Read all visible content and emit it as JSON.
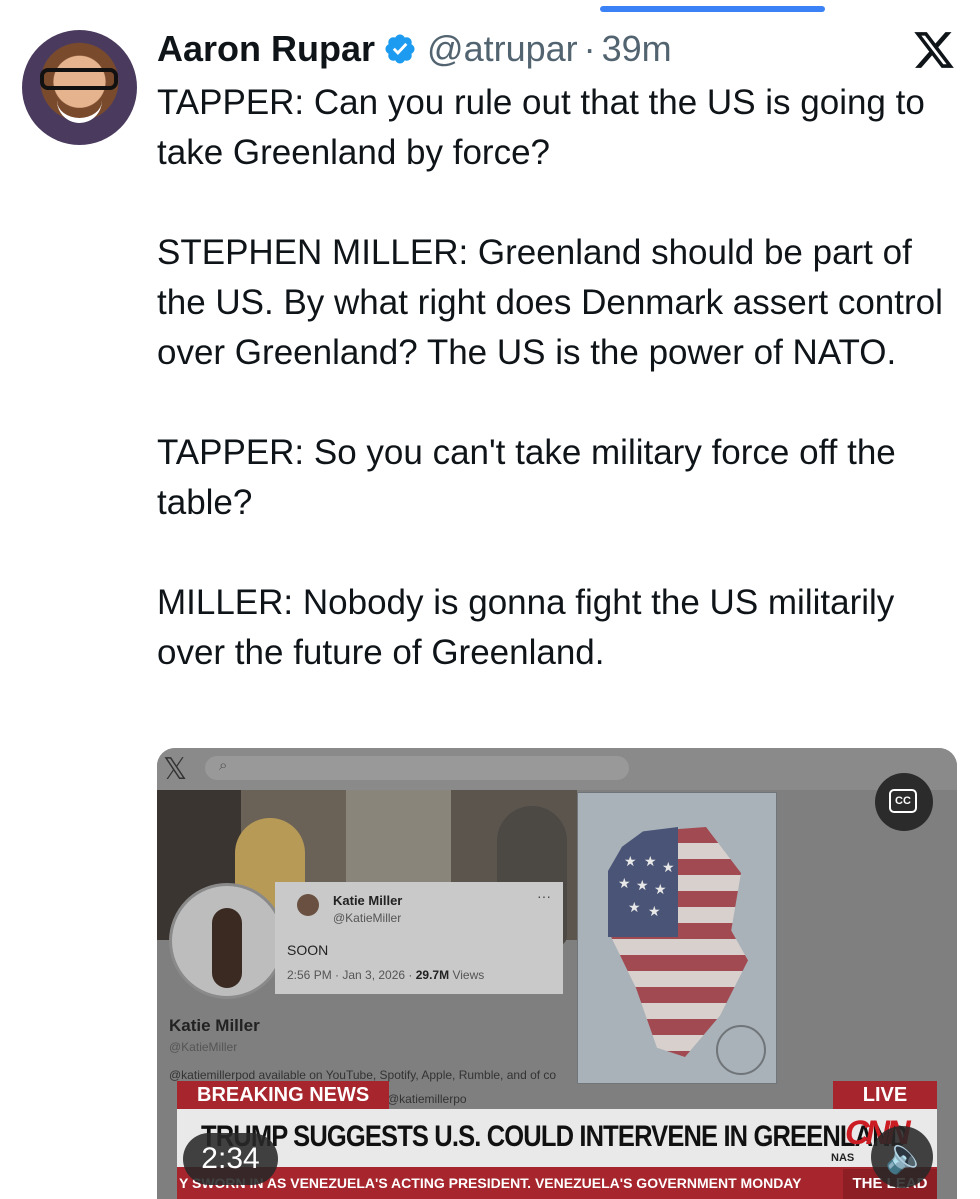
{
  "author": {
    "name": "Aaron Rupar",
    "handle": "@atrupar",
    "separator": "·",
    "time": "39m"
  },
  "tweet": {
    "text": "TAPPER: Can you rule out that the US is going to take Greenland by force?\n\nSTEPHEN MILLER: Greenland should be part of the US. By what right does Denmark assert control over Greenland? The US is the power of NATO.\n\nTAPPER: So you can't take military force off the table?\n\nMILLER: Nobody is gonna fight the US militarily over the future of Greenland."
  },
  "video": {
    "embedded_post": {
      "name": "Katie Miller",
      "handle": "@KatieMiller",
      "text": "SOON",
      "meta_prefix": "2:56 PM · Jan 3, 2026 · ",
      "views": "29.7M",
      "views_suffix": " Views",
      "more": "···"
    },
    "profile": {
      "name": "Katie Miller",
      "handle": "@KatieMiller",
      "bio": "@katiemillerpod available on YouTube, Spotify, Apple, Rumble, and of co",
      "bio2": "@katiemillerpo"
    },
    "cc_label": "CC",
    "breaking_label": "BREAKING NEWS",
    "live_label": "LIVE",
    "headline": "TRUMP SUGGESTS U.S. COULD INTERVENE IN GREENLAND",
    "network": "CNN",
    "market_label": "NAS",
    "ticker": "Y SWORN IN AS VENEZUELA'S ACTING PRESIDENT. VENEZUELA'S GOVERNMENT MONDAY",
    "show_label": "THE LEAD",
    "timer": "2:34"
  },
  "colors": {
    "verified": "#1d9bf0",
    "secondary_text": "#536471",
    "cnn_red": "#a7262e"
  }
}
